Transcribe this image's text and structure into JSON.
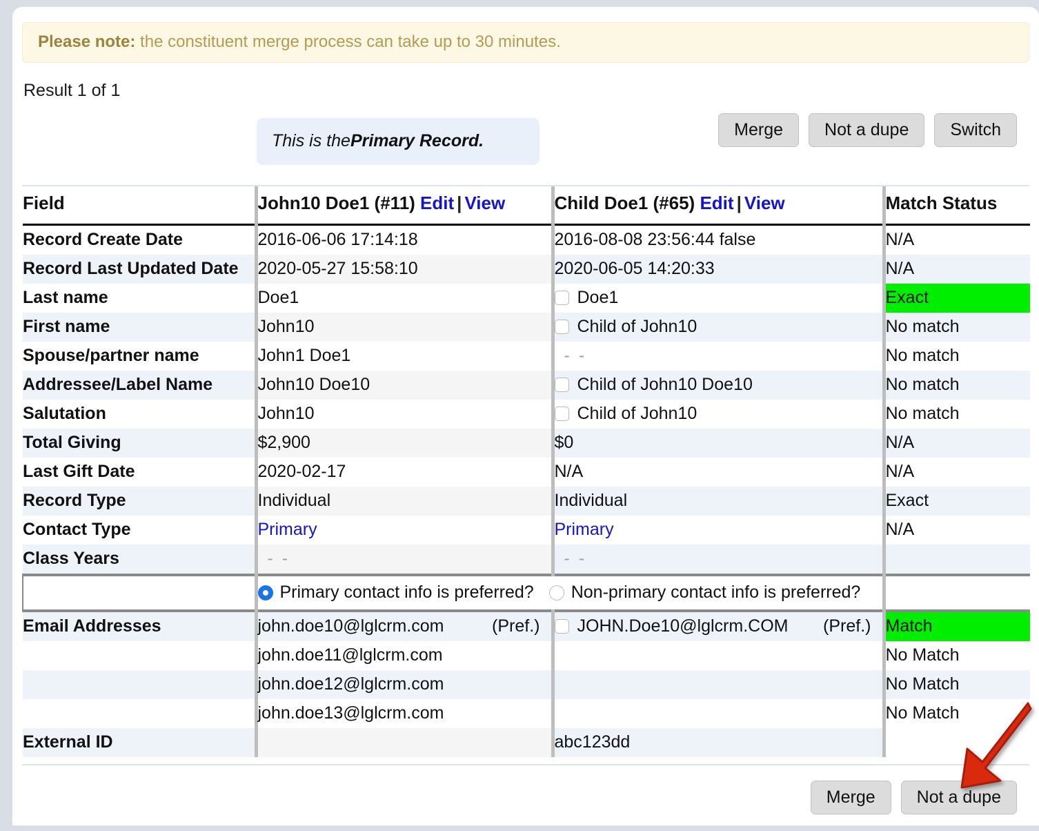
{
  "notice": {
    "lead": "Please note:",
    "text": " the constituent merge process can take up to 30 minutes."
  },
  "result_line": "Result 1 of 1",
  "primary_record_banner": {
    "prefix": "This is the ",
    "emphasis": "Primary Record."
  },
  "top_buttons": [
    {
      "label": "Merge"
    },
    {
      "label": "Not a dupe"
    },
    {
      "label": "Switch"
    }
  ],
  "bottom_buttons": [
    {
      "label": "Merge"
    },
    {
      "label": "Not a dupe"
    }
  ],
  "table": {
    "headers": {
      "field": "Field",
      "record_a": {
        "title": "John10 Doe1 (#11)",
        "edit": "Edit",
        "view": "View"
      },
      "record_b": {
        "title": "Child Doe1 (#65)",
        "edit": "Edit",
        "view": "View"
      },
      "match_status": "Match Status"
    },
    "rows": [
      {
        "field": "Record Create Date",
        "a": "2016-06-06 17:14:18",
        "b": "2016-08-08 23:56:44 false",
        "b_checkbox": false,
        "match": "N/A",
        "match_green": false
      },
      {
        "field": "Record Last Updated Date",
        "a": "2020-05-27 15:58:10",
        "b": "2020-06-05 14:20:33",
        "b_checkbox": false,
        "match": "N/A",
        "match_green": false
      },
      {
        "field": "Last name",
        "a": "Doe1",
        "b": "Doe1",
        "b_checkbox": true,
        "match": "Exact",
        "match_green": true
      },
      {
        "field": "First name",
        "a": "John10",
        "b": "Child of John10",
        "b_checkbox": true,
        "match": "No match",
        "match_green": false
      },
      {
        "field": "Spouse/partner name",
        "a": "John1 Doe1",
        "b": "- -",
        "b_checkbox": false,
        "b_is_dash": true,
        "match": "No match",
        "match_green": false
      },
      {
        "field": "Addressee/Label Name",
        "a": "John10 Doe10",
        "b": "Child of John10 Doe10",
        "b_checkbox": true,
        "match": "No match",
        "match_green": false
      },
      {
        "field": "Salutation",
        "a": "John10",
        "b": "Child of John10",
        "b_checkbox": true,
        "match": "No match",
        "match_green": false
      },
      {
        "field": "Total Giving",
        "a": "$2,900",
        "b": "$0",
        "b_checkbox": false,
        "match": "N/A",
        "match_green": false
      },
      {
        "field": "Last Gift Date",
        "a": "2020-02-17",
        "b": "N/A",
        "b_checkbox": false,
        "match": "N/A",
        "match_green": false
      },
      {
        "field": "Record Type",
        "a": "Individual",
        "b": "Individual",
        "b_checkbox": false,
        "match": "Exact",
        "match_green": false
      },
      {
        "field": "Contact Type",
        "a": "Primary",
        "b": "Primary",
        "a_is_link": true,
        "b_is_link": true,
        "b_checkbox": false,
        "match": "N/A",
        "match_green": false
      },
      {
        "field": "Class Years",
        "a": "- -",
        "b": "- -",
        "a_is_dash": true,
        "b_is_dash": true,
        "b_checkbox": false,
        "match": "",
        "match_green": false
      }
    ],
    "preferred_row": {
      "primary_label": "Primary contact info is preferred?",
      "nonprimary_label": "Non-primary contact info is preferred?",
      "selected": "primary"
    },
    "email_section": {
      "field_label": "Email Addresses",
      "pref_tag": "(Pref.)",
      "rows": [
        {
          "a": "john.doe10@lglcrm.com",
          "a_pref": true,
          "b": "JOHN.Doe10@lglcrm.COM",
          "b_pref": true,
          "b_checkbox": true,
          "match": "Match",
          "match_green": true
        },
        {
          "a": "john.doe11@lglcrm.com",
          "a_pref": false,
          "b": "",
          "b_pref": false,
          "b_checkbox": false,
          "match": "No Match",
          "match_green": false
        },
        {
          "a": "john.doe12@lglcrm.com",
          "a_pref": false,
          "b": "",
          "b_pref": false,
          "b_checkbox": false,
          "match": "No Match",
          "match_green": false
        },
        {
          "a": "john.doe13@lglcrm.com",
          "a_pref": false,
          "b": "",
          "b_pref": false,
          "b_checkbox": false,
          "match": "No Match",
          "match_green": false
        }
      ]
    },
    "external_id_row": {
      "field": "External ID",
      "a": "",
      "b": "abc123dd",
      "match": ""
    }
  },
  "colors": {
    "notice_bg": "#fcf8e3",
    "notice_text": "#b59a56",
    "link": "#1414cf",
    "match_green": "#00ef00",
    "row_alt": "#eef2f9",
    "button_bg": "#dcdcdc",
    "annotation_arrow": "#d92b11"
  }
}
